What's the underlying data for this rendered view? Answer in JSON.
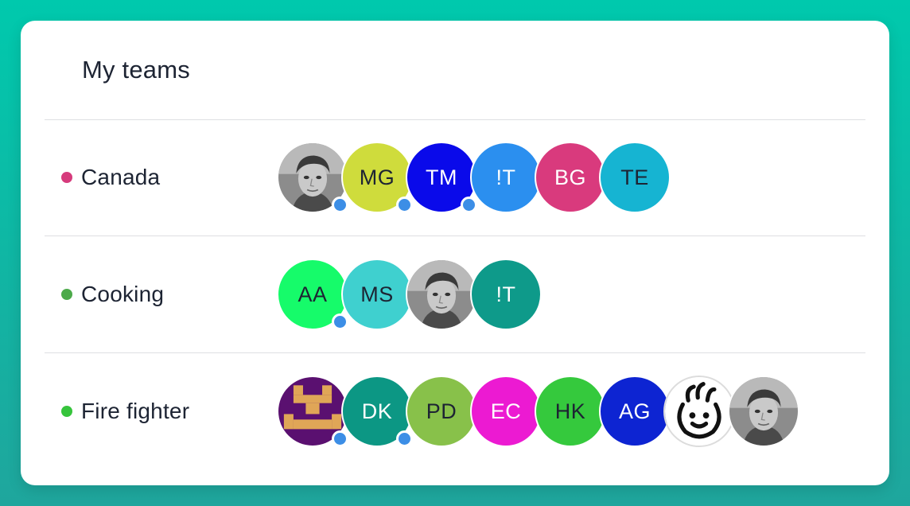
{
  "header": {
    "title": "My teams"
  },
  "colors": {
    "status_online": "#3c8ee6"
  },
  "teams": [
    {
      "name": "Canada",
      "dot_color": "#d63b7c",
      "members": [
        {
          "type": "photo",
          "icon": "person-photo-icon",
          "online": true
        },
        {
          "type": "initials",
          "initials": "MG",
          "bg": "#cfdc3c",
          "fg": "#1d2433",
          "online": true
        },
        {
          "type": "initials",
          "initials": "TM",
          "bg": "#0a0aea",
          "fg": "#ffffff",
          "online": true
        },
        {
          "type": "initials",
          "initials": "!T",
          "bg": "#2b8fef",
          "fg": "#ffffff",
          "online": false
        },
        {
          "type": "initials",
          "initials": "BG",
          "bg": "#d93a7d",
          "fg": "#ffffff",
          "online": false
        },
        {
          "type": "initials",
          "initials": "TE",
          "bg": "#16b4d2",
          "fg": "#1d2433",
          "online": false
        }
      ]
    },
    {
      "name": "Cooking",
      "dot_color": "#4caa4a",
      "members": [
        {
          "type": "initials",
          "initials": "AA",
          "bg": "#16fb6a",
          "fg": "#1d2433",
          "online": true
        },
        {
          "type": "initials",
          "initials": "MS",
          "bg": "#3fd0cf",
          "fg": "#1d2433",
          "online": false
        },
        {
          "type": "photo",
          "icon": "person-photo-icon",
          "online": false
        },
        {
          "type": "initials",
          "initials": "!T",
          "bg": "#0e9a8a",
          "fg": "#ffffff",
          "online": false
        }
      ]
    },
    {
      "name": "Fire fighter",
      "dot_color": "#36c43c",
      "members": [
        {
          "type": "pixel",
          "icon": "pixel-robot-icon",
          "online": true
        },
        {
          "type": "initials",
          "initials": "DK",
          "bg": "#0c9784",
          "fg": "#ffffff",
          "online": true
        },
        {
          "type": "initials",
          "initials": "PD",
          "bg": "#88c14a",
          "fg": "#1d2433",
          "online": false
        },
        {
          "type": "initials",
          "initials": "EC",
          "bg": "#ec1ad2",
          "fg": "#ffffff",
          "online": false
        },
        {
          "type": "initials",
          "initials": "HK",
          "bg": "#35c93d",
          "fg": "#1d2433",
          "online": false
        },
        {
          "type": "initials",
          "initials": "AG",
          "bg": "#0d24d2",
          "fg": "#ffffff",
          "online": false
        },
        {
          "type": "cartoon",
          "icon": "baby-face-icon",
          "online": false
        },
        {
          "type": "photo",
          "icon": "person-photo-icon",
          "online": false
        }
      ]
    }
  ]
}
